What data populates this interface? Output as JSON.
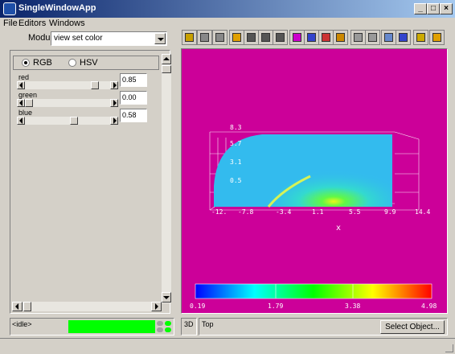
{
  "window": {
    "title": "SingleWindowApp"
  },
  "menu": [
    "File",
    "Editors",
    "Windows"
  ],
  "modules": {
    "label": "Modules",
    "selected": "view set color"
  },
  "color_mode": {
    "rgb_label": "RGB",
    "hsv_label": "HSV",
    "selected": "RGB"
  },
  "sliders": [
    {
      "label": "red",
      "value": "0.85",
      "level": 0.85
    },
    {
      "label": "green",
      "value": "0.00",
      "level": 0.0
    },
    {
      "label": "blue",
      "value": "0.58",
      "level": 0.58
    }
  ],
  "status": {
    "text": "<idle>",
    "progress_color": "#00ff00"
  },
  "viewport": {
    "background": "#cc0099",
    "axis_label": "x",
    "x_ticks": [
      "-12.",
      "-7.8",
      "-3.4",
      "1.1",
      "5.5",
      "9.9",
      "14.4"
    ],
    "y_ticks": [
      "8.3",
      "5.7",
      "3.1",
      "0.5"
    ],
    "colorbar_labels": [
      "0.19",
      "1.79",
      "3.38",
      "4.98"
    ]
  },
  "view_status": {
    "mode": "3D",
    "view": "Top"
  },
  "buttons": {
    "select_object": "Select Object..."
  },
  "toolbar_icons": [
    "light-icon",
    "camera-icon",
    "person-icon",
    "rotate-icon",
    "frame-icon",
    "scale-icon",
    "axes-icon",
    "cube-front-icon",
    "cube-side-icon",
    "cube-top-icon",
    "cube-half-icon",
    "print-icon",
    "save-icon",
    "box-icon",
    "cube-wire-icon",
    "bulb-icon",
    "lightning-icon"
  ]
}
